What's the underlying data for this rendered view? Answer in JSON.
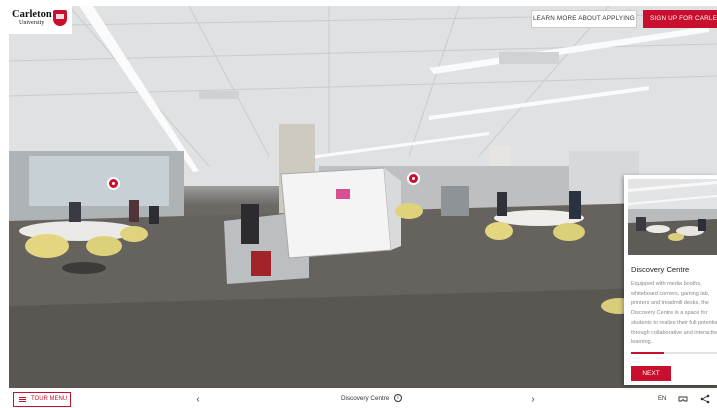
{
  "brand": {
    "name": "Carleton",
    "sub": "University",
    "color": "#c8102e"
  },
  "header": {
    "learn_more_label": "LEARN MORE ABOUT APPLYING",
    "signup_label": "SIGN UP FOR CARLETON"
  },
  "card": {
    "title": "Discovery Centre",
    "description_lines": [
      "Equipped with media booths,",
      "whiteboard corners, gaming lab,",
      "printers and treadmill desks, the",
      "Discovery Centre is a space for",
      "students to realize their full potential",
      "through collaborative and interactive",
      "learning."
    ],
    "progress": 0.38,
    "next_label": "NEXT"
  },
  "bottom_bar": {
    "tour_menu_label": "TOUR MENU",
    "prev_icon": "chevron-left-icon",
    "prev_glyph": "‹",
    "next_icon": "chevron-right-icon",
    "next_glyph": "›",
    "location": "Discovery Centre",
    "info_icon": "info-icon",
    "info_glyph": "i",
    "language": "EN",
    "vr_icon": "vr-headset-icon",
    "share_icon": "share-icon"
  },
  "hotspots": [
    {
      "name": "hotspot-left",
      "icon": "plus-icon"
    },
    {
      "name": "hotspot-center",
      "icon": "plus-icon"
    }
  ]
}
